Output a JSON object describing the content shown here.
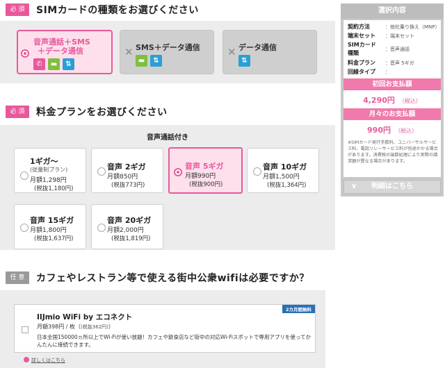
{
  "sections": {
    "sim": {
      "badge": "必 須",
      "title": "SIMカードの種類をお選びください"
    },
    "plan": {
      "badge": "必 須",
      "title": "料金プランをお選びください",
      "group_label": "音声通話付き"
    },
    "wifi": {
      "badge": "任 意",
      "title": "カフェやレストラン等で使える街中公衆wifiは必要ですか？"
    }
  },
  "sim_cards": [
    {
      "line1": "音声通話＋SMS",
      "line2": "＋データ通信",
      "selected": true
    },
    {
      "line1": "SMS＋データ通信",
      "selected": false
    },
    {
      "line1": "データ通信",
      "selected": false
    }
  ],
  "plans": [
    {
      "name": "1ギガ～",
      "sub": "(従量制プラン)",
      "price": "月額1,298円",
      "tax": "(税抜1,180円)",
      "selected": false
    },
    {
      "name": "音声 2ギガ",
      "price": "月額850円",
      "tax": "(税抜773円)",
      "selected": false
    },
    {
      "name": "音声 5ギガ",
      "price": "月額990円",
      "tax": "(税抜900円)",
      "selected": true
    },
    {
      "name": "音声 10ギガ",
      "price": "月額1,500円",
      "tax": "(税抜1,364円)",
      "selected": false
    },
    {
      "name": "音声 15ギガ",
      "price": "月額1,800円",
      "tax": "(税抜1,637円)",
      "selected": false
    },
    {
      "name": "音声 20ギガ",
      "price": "月額2,000円",
      "tax": "(税抜1,819円)",
      "selected": false
    }
  ],
  "sidebar": {
    "title": "選択内容",
    "rows": [
      {
        "key": "契約方法",
        "val": "：他社乗り換え（MNP）"
      },
      {
        "key": "端末セット",
        "val": "：端末セット"
      },
      {
        "key": "SIMカード",
        "val": "：音声通話"
      },
      {
        "key": "種類",
        "val": ""
      },
      {
        "key": "料金プラン",
        "val": "：音声 5ギガ"
      },
      {
        "key": "回線タイプ",
        "val": "："
      }
    ],
    "initial_label": "初回お支払額",
    "initial_amount": "4,290円",
    "initial_tax": "（税込）",
    "monthly_label": "月々のお支払額",
    "monthly_amount": "990円",
    "monthly_tax": "（税込）",
    "note": "※SIMカード発行手数料、ユニバーサルサービス料、電話リレーサービス料が別途かかる場合があります。消費税の端数処理により実際の請求額が異なる場合があります。",
    "detail_button": "明細はこちら"
  },
  "wifi_option": {
    "tag": "2カ月間無料",
    "title": "IIJmio WiFi by エコネクト",
    "price": "月額398円 / 枚",
    "price_tax": "(税抜362円)",
    "desc": "日本全国150000ヵ所以上でWi-Fiが使い放題！カフェや飲食店など街中の対応Wi-Fiスポットで専用アプリを使ってかんたんに接続できます。",
    "link": "詳しくはこちら"
  }
}
